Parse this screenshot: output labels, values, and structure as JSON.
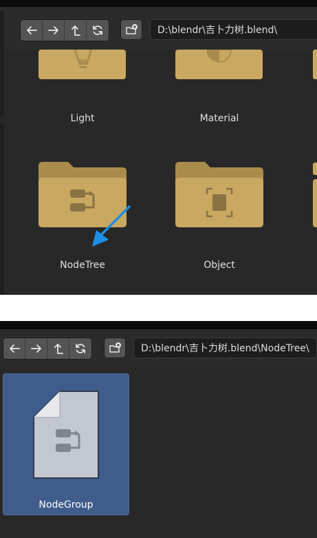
{
  "panel_top": {
    "toolbar": {
      "back_icon": "arrow-left-icon",
      "forward_icon": "arrow-right-icon",
      "parent_icon": "parent-directory-icon",
      "refresh_icon": "refresh-icon",
      "new_folder_icon": "new-folder-icon",
      "path": "D:\\blendr\\吉卜力树.blend\\"
    },
    "items": [
      {
        "label": "Light",
        "icon": "lightbulb-icon"
      },
      {
        "label": "Material",
        "icon": "material-sphere-icon"
      },
      {
        "label": "NodeTree",
        "icon": "node-tree-icon"
      },
      {
        "label": "Object",
        "icon": "object-icon"
      }
    ],
    "annotation_arrow_color": "#1e8fe6"
  },
  "panel_bottom": {
    "toolbar": {
      "back_icon": "arrow-left-icon",
      "forward_icon": "arrow-right-icon",
      "parent_icon": "parent-directory-icon",
      "refresh_icon": "refresh-icon",
      "new_folder_icon": "new-folder-icon",
      "path": "D:\\blendr\\吉卜力树.blend\\NodeTree\\"
    },
    "items": [
      {
        "label": "NodeGroup",
        "icon": "node-group-file-icon",
        "selected": true
      }
    ]
  },
  "colors": {
    "folder": "#c9a961",
    "folder_dark": "#a98c4c",
    "selection": "#3f5c8b",
    "panel_bg": "#282828"
  }
}
